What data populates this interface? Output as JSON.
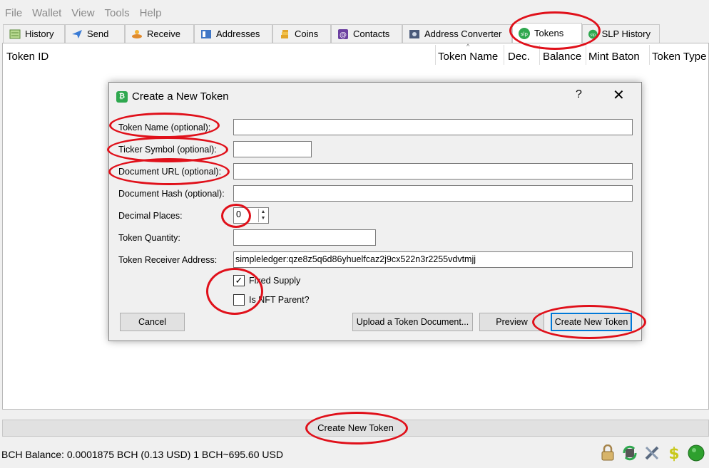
{
  "menu": [
    "File",
    "Wallet",
    "View",
    "Tools",
    "Help"
  ],
  "tabs": [
    {
      "label": "History",
      "icon": "history-icon"
    },
    {
      "label": "Send",
      "icon": "send-icon"
    },
    {
      "label": "Receive",
      "icon": "receive-icon"
    },
    {
      "label": "Addresses",
      "icon": "addresses-icon"
    },
    {
      "label": "Coins",
      "icon": "coins-icon"
    },
    {
      "label": "Contacts",
      "icon": "contacts-icon"
    },
    {
      "label": "Address Converter",
      "icon": "converter-icon"
    },
    {
      "label": "Tokens",
      "icon": "slp-icon"
    },
    {
      "label": "SLP History",
      "icon": "slp-icon"
    }
  ],
  "table_headers": [
    "Token ID",
    "Token Name",
    "Dec.",
    "Balance",
    "Mint Baton",
    "Token Type"
  ],
  "dialog": {
    "title": "Create a New Token",
    "help": "?",
    "close": "✕",
    "labels": {
      "token_name": "Token Name (optional):",
      "ticker": "Ticker Symbol (optional):",
      "doc_url": "Document URL (optional):",
      "doc_hash": "Document Hash (optional):",
      "decimals": "Decimal Places:",
      "quantity": "Token Quantity:",
      "receiver": "Token Receiver Address:"
    },
    "values": {
      "token_name": "",
      "ticker": "",
      "doc_url": "",
      "doc_hash": "",
      "decimals": "0",
      "quantity": "",
      "receiver": "simpleledger:qze8z5q6d86yhuelfcaz2j9cx522n3r2255vdvtmjj"
    },
    "checkboxes": {
      "fixed_supply": {
        "label": "Fixed Supply",
        "checked": "✓"
      },
      "nft_parent": {
        "label": "Is NFT Parent?",
        "checked": ""
      }
    },
    "buttons": {
      "cancel": "Cancel",
      "upload": "Upload a Token Document...",
      "preview": "Preview",
      "create": "Create New Token"
    }
  },
  "bottom_button": "Create New Token",
  "status": "BCH Balance: 0.0001875 BCH (0.13 USD) 1 BCH~695.60 USD",
  "status_icons": [
    "lock-icon",
    "sync-icon",
    "tools-icon",
    "slp-dollar-icon",
    "network-status-icon"
  ],
  "colors": {
    "annotation": "#e0101a",
    "slp_green": "#2fa84f",
    "accent": "#0078d7"
  }
}
